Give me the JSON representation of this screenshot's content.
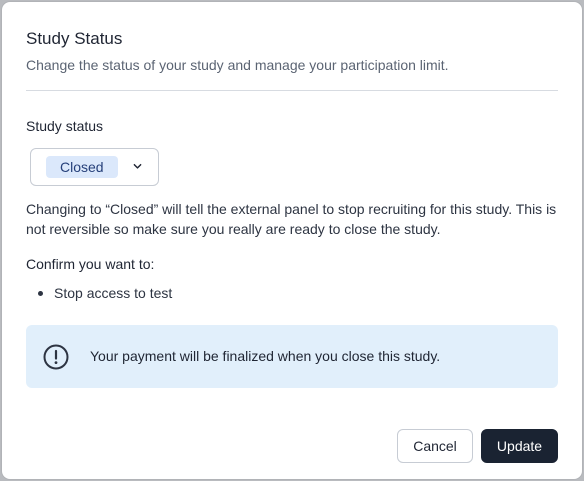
{
  "dialog": {
    "title": "Study Status",
    "subtitle": "Change the status of your study and manage your participation limit."
  },
  "status_field": {
    "label": "Study status",
    "selected_value": "Closed"
  },
  "description": "Changing to “Closed” will tell the external panel to stop recruiting for this study. This is not reversible so make sure you really are ready to close the study.",
  "confirm": {
    "label": "Confirm you want to:",
    "items": [
      "Stop access to test"
    ]
  },
  "info_banner": {
    "icon": "exclamation-circle-icon",
    "text": "Your payment will be finalized when you close this study."
  },
  "actions": {
    "cancel_label": "Cancel",
    "update_label": "Update"
  },
  "colors": {
    "primary_button": "#1a2332",
    "pill_background": "#dbe8fb",
    "pill_text": "#26407a",
    "info_background": "#e1effb"
  }
}
